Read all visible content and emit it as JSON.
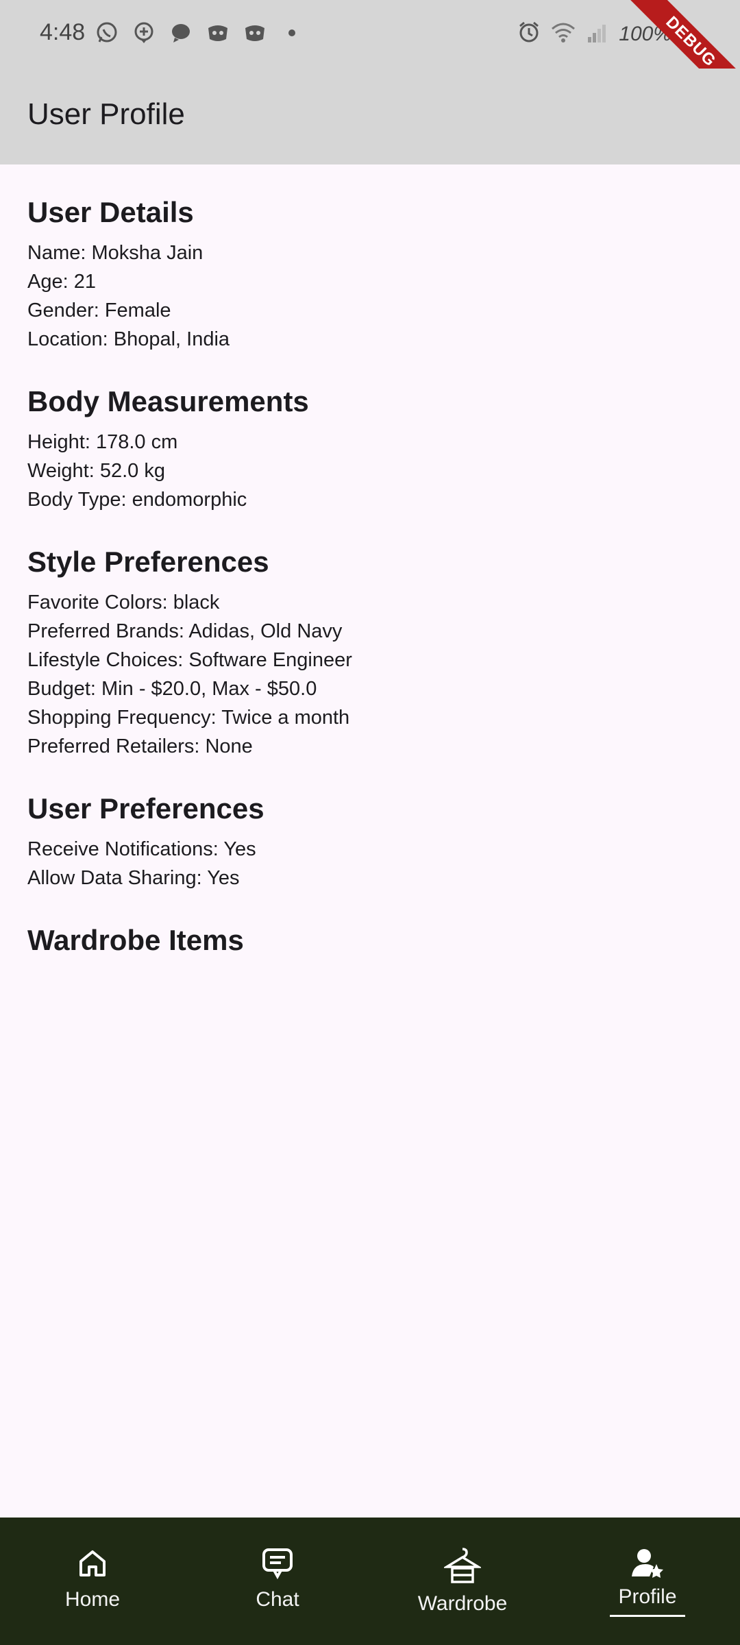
{
  "status_bar": {
    "time": "4:48",
    "battery": "100%",
    "debug_label": "DEBUG"
  },
  "app_bar": {
    "title": "User Profile"
  },
  "sections": {
    "user_details": {
      "title": "User Details",
      "rows": [
        "Name: Moksha Jain",
        "Age: 21",
        "Gender: Female",
        "Location: Bhopal, India"
      ]
    },
    "body_measurements": {
      "title": "Body Measurements",
      "rows": [
        "Height: 178.0 cm",
        "Weight: 52.0 kg",
        "Body Type: endomorphic"
      ]
    },
    "style_preferences": {
      "title": "Style Preferences",
      "rows": [
        "Favorite Colors: black",
        "Preferred Brands: Adidas, Old Navy",
        "Lifestyle Choices: Software Engineer",
        "Budget: Min - $20.0, Max - $50.0",
        "Shopping Frequency: Twice a month",
        "Preferred Retailers: None"
      ]
    },
    "user_preferences": {
      "title": "User Preferences",
      "rows": [
        "Receive Notifications: Yes",
        "Allow Data Sharing: Yes"
      ]
    },
    "wardrobe_items": {
      "title": "Wardrobe Items"
    }
  },
  "bottom_nav": {
    "items": [
      {
        "label": "Home",
        "icon": "home-icon"
      },
      {
        "label": "Chat",
        "icon": "chat-icon"
      },
      {
        "label": "Wardrobe",
        "icon": "hanger-icon"
      },
      {
        "label": "Profile",
        "icon": "profile-icon"
      }
    ],
    "active_index": 3
  },
  "colors": {
    "status_bar_bg": "#d6d6d6",
    "page_bg": "#fdf7fd",
    "bottom_nav_bg": "#1f2a14",
    "debug_banner": "#b71c1c"
  }
}
